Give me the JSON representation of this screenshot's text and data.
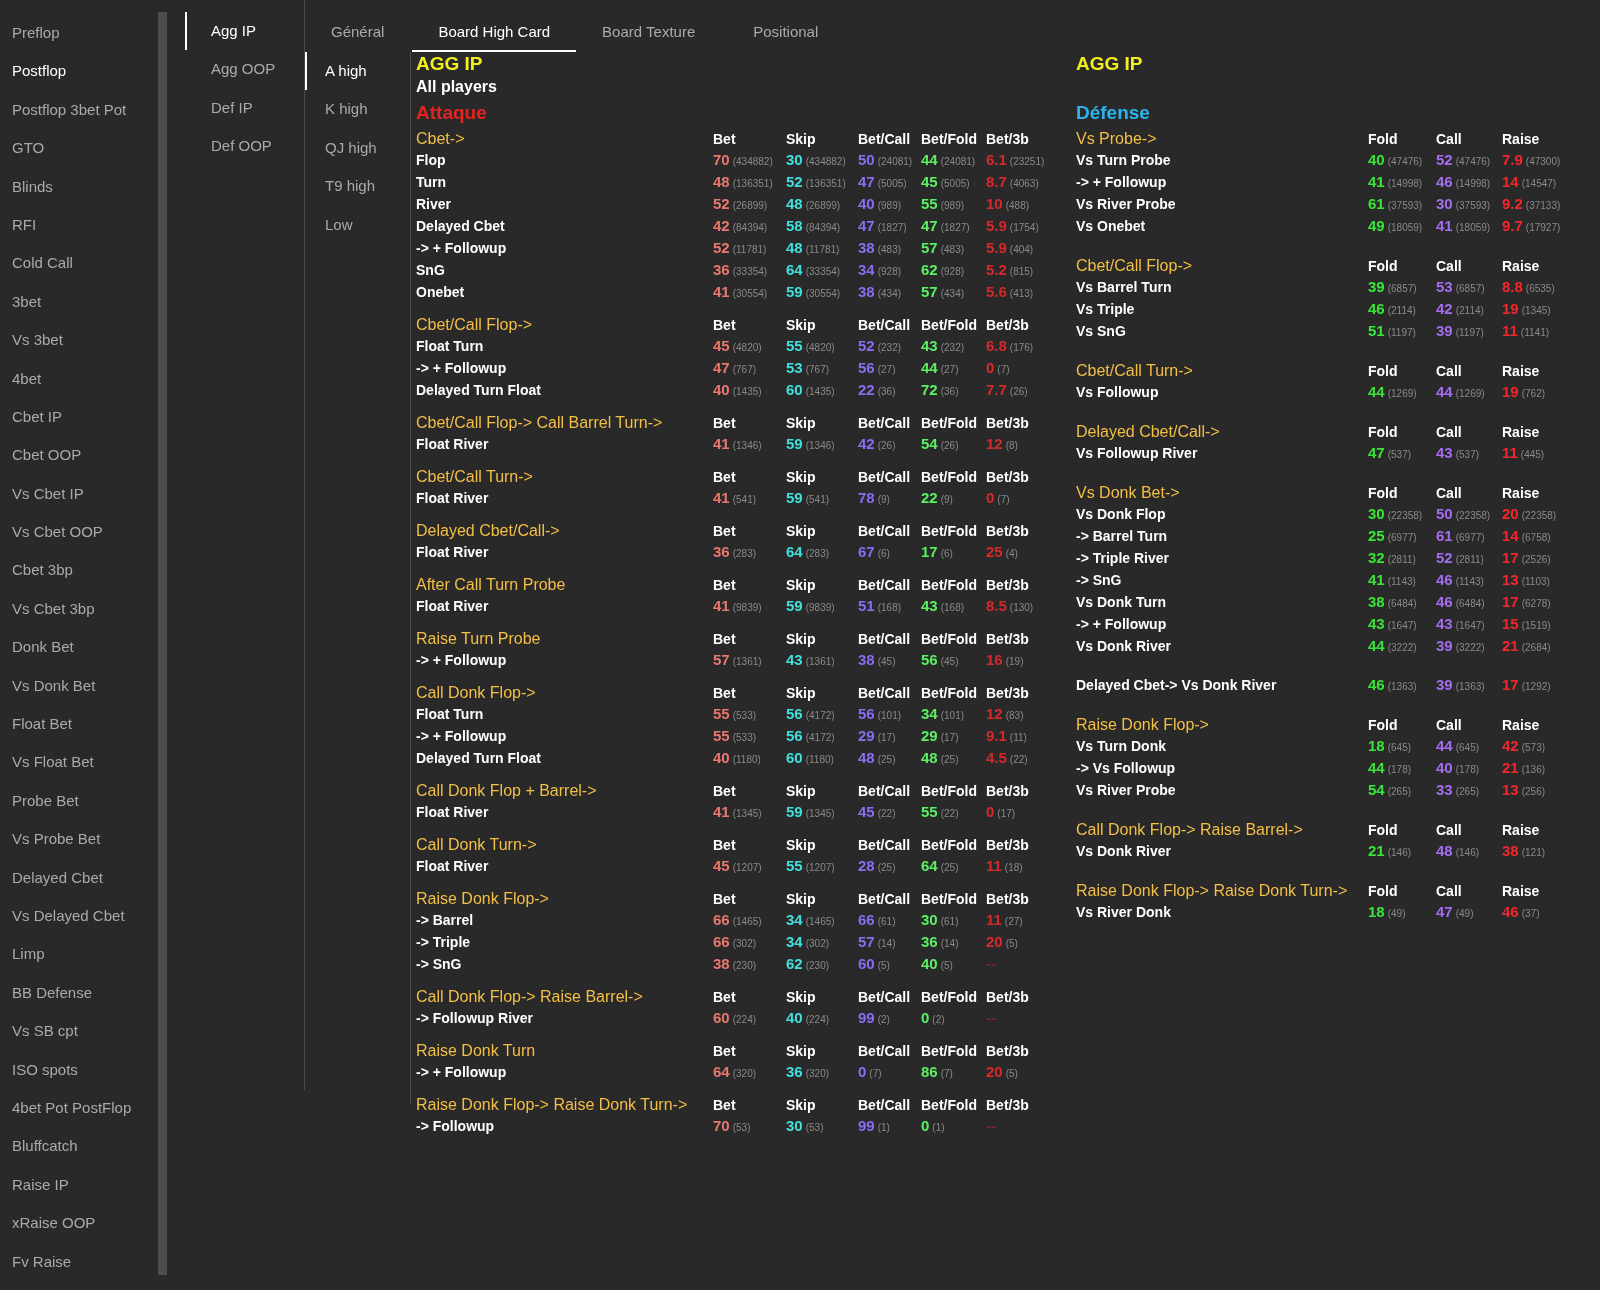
{
  "sidebar": {
    "items": [
      {
        "label": "Preflop",
        "selected": false
      },
      {
        "label": "Postflop",
        "selected": true
      },
      {
        "label": "Postflop 3bet Pot",
        "selected": false
      },
      {
        "label": "GTO",
        "selected": false
      },
      {
        "label": "Blinds",
        "selected": false
      },
      {
        "label": "RFI",
        "selected": false
      },
      {
        "label": "Cold Call",
        "selected": false
      },
      {
        "label": "3bet",
        "selected": false
      },
      {
        "label": "Vs 3bet",
        "selected": false
      },
      {
        "label": "4bet",
        "selected": false
      },
      {
        "label": "Cbet IP",
        "selected": false
      },
      {
        "label": "Cbet OOP",
        "selected": false
      },
      {
        "label": "Vs Cbet IP",
        "selected": false
      },
      {
        "label": "Vs Cbet OOP",
        "selected": false
      },
      {
        "label": "Cbet 3bp",
        "selected": false
      },
      {
        "label": "Vs Cbet 3bp",
        "selected": false
      },
      {
        "label": "Donk Bet",
        "selected": false
      },
      {
        "label": "Vs Donk Bet",
        "selected": false
      },
      {
        "label": "Float Bet",
        "selected": false
      },
      {
        "label": "Vs Float Bet",
        "selected": false
      },
      {
        "label": "Probe Bet",
        "selected": false
      },
      {
        "label": "Vs Probe Bet",
        "selected": false
      },
      {
        "label": "Delayed Cbet",
        "selected": false
      },
      {
        "label": "Vs Delayed Cbet",
        "selected": false
      },
      {
        "label": "Limp",
        "selected": false
      },
      {
        "label": "BB Defense",
        "selected": false
      },
      {
        "label": "Vs SB cpt",
        "selected": false
      },
      {
        "label": "ISO spots",
        "selected": false
      },
      {
        "label": "4bet Pot PostFlop",
        "selected": false
      },
      {
        "label": "Bluffcatch",
        "selected": false
      },
      {
        "label": "Raise IP",
        "selected": false
      },
      {
        "label": "xRaise OOP",
        "selected": false
      },
      {
        "label": "Fv Raise",
        "selected": false
      }
    ]
  },
  "role_menu": {
    "items": [
      {
        "label": "Agg IP",
        "selected": true
      },
      {
        "label": "Agg OOP",
        "selected": false
      },
      {
        "label": "Def IP",
        "selected": false
      },
      {
        "label": "Def OOP",
        "selected": false
      }
    ]
  },
  "tabs": [
    {
      "label": "Général",
      "selected": false
    },
    {
      "label": "Board High Card",
      "selected": true
    },
    {
      "label": "Board Texture",
      "selected": false
    },
    {
      "label": "Positional",
      "selected": false
    }
  ],
  "board_menu": {
    "items": [
      {
        "label": "A high",
        "selected": true
      },
      {
        "label": "K high",
        "selected": false
      },
      {
        "label": "QJ high",
        "selected": false
      },
      {
        "label": "T9 high",
        "selected": false
      },
      {
        "label": "Low",
        "selected": false
      }
    ]
  },
  "attack": {
    "heading": "AGG IP",
    "subheading": "All players",
    "title": "Attaque",
    "measures": [
      {
        "color": "#e8776e"
      },
      {
        "color": "#3fe0dc"
      },
      {
        "color": "#8b6cf2"
      },
      {
        "color": "#5cef64"
      },
      {
        "color": "#d7282c"
      }
    ],
    "sections": [
      {
        "title": "Cbet->",
        "headers": [
          "Bet",
          "Skip",
          "Bet/Call",
          "Bet/Fold",
          "Bet/3b"
        ],
        "rows": [
          {
            "label": "Flop",
            "cells": [
              [
                "70",
                "(434882)"
              ],
              [
                "30",
                "(434882)"
              ],
              [
                "50",
                "(24081)"
              ],
              [
                "44",
                "(24081)"
              ],
              [
                "6.1",
                "(23251)"
              ]
            ]
          },
          {
            "label": "Turn",
            "cells": [
              [
                "48",
                "(136351)"
              ],
              [
                "52",
                "(136351)"
              ],
              [
                "47",
                "(5005)"
              ],
              [
                "45",
                "(5005)"
              ],
              [
                "8.7",
                "(4063)"
              ]
            ]
          },
          {
            "label": "River",
            "cells": [
              [
                "52",
                "(26899)"
              ],
              [
                "48",
                "(26899)"
              ],
              [
                "40",
                "(989)"
              ],
              [
                "55",
                "(989)"
              ],
              [
                "10",
                "(488)"
              ]
            ]
          },
          {
            "label": "Delayed Cbet",
            "cells": [
              [
                "42",
                "(84394)"
              ],
              [
                "58",
                "(84394)"
              ],
              [
                "47",
                "(1827)"
              ],
              [
                "47",
                "(1827)"
              ],
              [
                "5.9",
                "(1754)"
              ]
            ]
          },
          {
            "label": "-> + Followup",
            "cells": [
              [
                "52",
                "(11781)"
              ],
              [
                "48",
                "(11781)"
              ],
              [
                "38",
                "(483)"
              ],
              [
                "57",
                "(483)"
              ],
              [
                "5.9",
                "(404)"
              ]
            ]
          },
          {
            "label": "SnG",
            "cells": [
              [
                "36",
                "(33354)"
              ],
              [
                "64",
                "(33354)"
              ],
              [
                "34",
                "(928)"
              ],
              [
                "62",
                "(928)"
              ],
              [
                "5.2",
                "(815)"
              ]
            ]
          },
          {
            "label": "Onebet",
            "cells": [
              [
                "41",
                "(30554)"
              ],
              [
                "59",
                "(30554)"
              ],
              [
                "38",
                "(434)"
              ],
              [
                "57",
                "(434)"
              ],
              [
                "5.6",
                "(413)"
              ]
            ]
          }
        ]
      },
      {
        "title": "Cbet/Call Flop->",
        "headers": [
          "Bet",
          "Skip",
          "Bet/Call",
          "Bet/Fold",
          "Bet/3b"
        ],
        "rows": [
          {
            "label": "Float Turn",
            "cells": [
              [
                "45",
                "(4820)"
              ],
              [
                "55",
                "(4820)"
              ],
              [
                "52",
                "(232)"
              ],
              [
                "43",
                "(232)"
              ],
              [
                "6.8",
                "(176)"
              ]
            ]
          },
          {
            "label": "-> + Followup",
            "cells": [
              [
                "47",
                "(767)"
              ],
              [
                "53",
                "(767)"
              ],
              [
                "56",
                "(27)"
              ],
              [
                "44",
                "(27)"
              ],
              [
                "0",
                "(7)"
              ]
            ]
          },
          {
            "label": "Delayed Turn Float",
            "cells": [
              [
                "40",
                "(1435)"
              ],
              [
                "60",
                "(1435)"
              ],
              [
                "22",
                "(36)"
              ],
              [
                "72",
                "(36)"
              ],
              [
                "7.7",
                "(26)"
              ]
            ]
          }
        ]
      },
      {
        "title": "Cbet/Call Flop-> Call Barrel Turn->",
        "headers": [
          "Bet",
          "Skip",
          "Bet/Call",
          "Bet/Fold",
          "Bet/3b"
        ],
        "rows": [
          {
            "label": "Float River",
            "cells": [
              [
                "41",
                "(1346)"
              ],
              [
                "59",
                "(1346)"
              ],
              [
                "42",
                "(26)"
              ],
              [
                "54",
                "(26)"
              ],
              [
                "12",
                "(8)"
              ]
            ]
          }
        ]
      },
      {
        "title": "Cbet/Call Turn->",
        "headers": [
          "Bet",
          "Skip",
          "Bet/Call",
          "Bet/Fold",
          "Bet/3b"
        ],
        "rows": [
          {
            "label": "Float River",
            "cells": [
              [
                "41",
                "(541)"
              ],
              [
                "59",
                "(541)"
              ],
              [
                "78",
                "(9)"
              ],
              [
                "22",
                "(9)"
              ],
              [
                "0",
                "(7)"
              ]
            ]
          }
        ]
      },
      {
        "title": "Delayed Cbet/Call->",
        "headers": [
          "Bet",
          "Skip",
          "Bet/Call",
          "Bet/Fold",
          "Bet/3b"
        ],
        "rows": [
          {
            "label": "Float River",
            "cells": [
              [
                "36",
                "(283)"
              ],
              [
                "64",
                "(283)"
              ],
              [
                "67",
                "(6)"
              ],
              [
                "17",
                "(6)"
              ],
              [
                "25",
                "(4)"
              ]
            ]
          }
        ]
      },
      {
        "title": "After Call Turn Probe",
        "headers": [
          "Bet",
          "Skip",
          "Bet/Call",
          "Bet/Fold",
          "Bet/3b"
        ],
        "rows": [
          {
            "label": "Float River",
            "cells": [
              [
                "41",
                "(9839)"
              ],
              [
                "59",
                "(9839)"
              ],
              [
                "51",
                "(168)"
              ],
              [
                "43",
                "(168)"
              ],
              [
                "8.5",
                "(130)"
              ]
            ]
          }
        ]
      },
      {
        "title": "Raise Turn Probe",
        "headers": [
          "Bet",
          "Skip",
          "Bet/Call",
          "Bet/Fold",
          "Bet/3b"
        ],
        "rows": [
          {
            "label": "-> + Followup",
            "cells": [
              [
                "57",
                "(1361)"
              ],
              [
                "43",
                "(1361)"
              ],
              [
                "38",
                "(45)"
              ],
              [
                "56",
                "(45)"
              ],
              [
                "16",
                "(19)"
              ]
            ]
          }
        ]
      },
      {
        "title": "Call Donk Flop->",
        "headers": [
          "Bet",
          "Skip",
          "Bet/Call",
          "Bet/Fold",
          "Bet/3b"
        ],
        "rows": [
          {
            "label": "Float Turn",
            "cells": [
              [
                "55",
                "(533)"
              ],
              [
                "56",
                "(4172)"
              ],
              [
                "56",
                "(101)"
              ],
              [
                "34",
                "(101)"
              ],
              [
                "12",
                "(83)"
              ]
            ]
          },
          {
            "label": "-> + Followup",
            "cells": [
              [
                "55",
                "(533)"
              ],
              [
                "56",
                "(4172)"
              ],
              [
                "29",
                "(17)"
              ],
              [
                "29",
                "(17)"
              ],
              [
                "9.1",
                "(11)"
              ]
            ]
          },
          {
            "label": "Delayed Turn Float",
            "cells": [
              [
                "40",
                "(1180)"
              ],
              [
                "60",
                "(1180)"
              ],
              [
                "48",
                "(25)"
              ],
              [
                "48",
                "(25)"
              ],
              [
                "4.5",
                "(22)"
              ]
            ]
          }
        ]
      },
      {
        "title": "Call Donk Flop + Barrel->",
        "headers": [
          "Bet",
          "Skip",
          "Bet/Call",
          "Bet/Fold",
          "Bet/3b"
        ],
        "rows": [
          {
            "label": "Float River",
            "cells": [
              [
                "41",
                "(1345)"
              ],
              [
                "59",
                "(1345)"
              ],
              [
                "45",
                "(22)"
              ],
              [
                "55",
                "(22)"
              ],
              [
                "0",
                "(17)"
              ]
            ]
          }
        ]
      },
      {
        "title": "Call Donk Turn->",
        "headers": [
          "Bet",
          "Skip",
          "Bet/Call",
          "Bet/Fold",
          "Bet/3b"
        ],
        "rows": [
          {
            "label": "Float River",
            "cells": [
              [
                "45",
                "(1207)"
              ],
              [
                "55",
                "(1207)"
              ],
              [
                "28",
                "(25)"
              ],
              [
                "64",
                "(25)"
              ],
              [
                "11",
                "(18)"
              ]
            ]
          }
        ]
      },
      {
        "title": "Raise Donk Flop->",
        "headers": [
          "Bet",
          "Skip",
          "Bet/Call",
          "Bet/Fold",
          "Bet/3b"
        ],
        "rows": [
          {
            "label": "-> Barrel",
            "cells": [
              [
                "66",
                "(1465)"
              ],
              [
                "34",
                "(1465)"
              ],
              [
                "66",
                "(61)"
              ],
              [
                "30",
                "(61)"
              ],
              [
                "11",
                "(27)"
              ]
            ]
          },
          {
            "label": "-> Triple",
            "cells": [
              [
                "66",
                "(302)"
              ],
              [
                "34",
                "(302)"
              ],
              [
                "57",
                "(14)"
              ],
              [
                "36",
                "(14)"
              ],
              [
                "20",
                "(5)"
              ]
            ]
          },
          {
            "label": "-> SnG",
            "cells": [
              [
                "38",
                "(230)"
              ],
              [
                "62",
                "(230)"
              ],
              [
                "60",
                "(5)"
              ],
              [
                "40",
                "(5)"
              ],
              [
                "--"
              ]
            ]
          }
        ]
      },
      {
        "title": "Call Donk Flop-> Raise Barrel->",
        "headers": [
          "Bet",
          "Skip",
          "Bet/Call",
          "Bet/Fold",
          "Bet/3b"
        ],
        "rows": [
          {
            "label": "-> Followup River",
            "cells": [
              [
                "60",
                "(224)"
              ],
              [
                "40",
                "(224)"
              ],
              [
                "99",
                "(2)"
              ],
              [
                "0",
                "(2)"
              ],
              [
                "--"
              ]
            ]
          }
        ]
      },
      {
        "title": "Raise Donk Turn",
        "headers": [
          "Bet",
          "Skip",
          "Bet/Call",
          "Bet/Fold",
          "Bet/3b"
        ],
        "rows": [
          {
            "label": "-> + Followup",
            "cells": [
              [
                "64",
                "(320)"
              ],
              [
                "36",
                "(320)"
              ],
              [
                "0",
                "(7)"
              ],
              [
                "86",
                "(7)"
              ],
              [
                "20",
                "(5)"
              ]
            ]
          }
        ]
      },
      {
        "title": "Raise Donk Flop-> Raise Donk Turn->",
        "headers": [
          "Bet",
          "Skip",
          "Bet/Call",
          "Bet/Fold",
          "Bet/3b"
        ],
        "rows": [
          {
            "label": "-> Followup",
            "cells": [
              [
                "70",
                "(53)"
              ],
              [
                "30",
                "(53)"
              ],
              [
                "99",
                "(1)"
              ],
              [
                "0",
                "(1)"
              ],
              [
                "--"
              ]
            ]
          }
        ]
      }
    ]
  },
  "defense": {
    "heading": "AGG IP",
    "title": "Défense",
    "measures": [
      {
        "color": "#37e637"
      },
      {
        "color": "#a66cf0"
      },
      {
        "color": "#f5262b"
      }
    ],
    "sections": [
      {
        "title": "Vs Probe->",
        "headers": [
          "Fold",
          "Call",
          "Raise"
        ],
        "rows": [
          {
            "label": "Vs Turn Probe",
            "cells": [
              [
                "40",
                "(47476)"
              ],
              [
                "52",
                "(47476)"
              ],
              [
                "7.9",
                "(47300)"
              ]
            ]
          },
          {
            "label": "-> + Followup",
            "cells": [
              [
                "41",
                "(14998)"
              ],
              [
                "46",
                "(14998)"
              ],
              [
                "14",
                "(14547)"
              ]
            ]
          },
          {
            "label": "Vs River Probe",
            "cells": [
              [
                "61",
                "(37593)"
              ],
              [
                "30",
                "(37593)"
              ],
              [
                "9.2",
                "(37133)"
              ]
            ]
          },
          {
            "label": "Vs Onebet",
            "cells": [
              [
                "49",
                "(18059)"
              ],
              [
                "41",
                "(18059)"
              ],
              [
                "9.7",
                "(17927)"
              ]
            ]
          }
        ]
      },
      {
        "title": "Cbet/Call Flop->",
        "headers": [
          "Fold",
          "Call",
          "Raise"
        ],
        "rows": [
          {
            "label": "Vs Barrel Turn",
            "cells": [
              [
                "39",
                "(6857)"
              ],
              [
                "53",
                "(6857)"
              ],
              [
                "8.8",
                "(6535)"
              ]
            ]
          },
          {
            "label": "Vs Triple",
            "cells": [
              [
                "46",
                "(2114)"
              ],
              [
                "42",
                "(2114)"
              ],
              [
                "19",
                "(1345)"
              ]
            ]
          },
          {
            "label": "Vs SnG",
            "cells": [
              [
                "51",
                "(1197)"
              ],
              [
                "39",
                "(1197)"
              ],
              [
                "11",
                "(1141)"
              ]
            ]
          }
        ]
      },
      {
        "title": "Cbet/Call Turn->",
        "headers": [
          "Fold",
          "Call",
          "Raise"
        ],
        "rows": [
          {
            "label": "Vs Followup",
            "cells": [
              [
                "44",
                "(1269)"
              ],
              [
                "44",
                "(1269)"
              ],
              [
                "19",
                "(762)"
              ]
            ]
          }
        ]
      },
      {
        "title": "Delayed Cbet/Call->",
        "headers": [
          "Fold",
          "Call",
          "Raise"
        ],
        "rows": [
          {
            "label": "Vs Followup River",
            "cells": [
              [
                "47",
                "(537)"
              ],
              [
                "43",
                "(537)"
              ],
              [
                "11",
                "(445)"
              ]
            ]
          }
        ]
      },
      {
        "title": "Vs Donk Bet->",
        "headers": [
          "Fold",
          "Call",
          "Raise"
        ],
        "rows": [
          {
            "label": "Vs Donk Flop",
            "cells": [
              [
                "30",
                "(22358)"
              ],
              [
                "50",
                "(22358)"
              ],
              [
                "20",
                "(22358)"
              ]
            ]
          },
          {
            "label": "-> Barrel Turn",
            "cells": [
              [
                "25",
                "(6977)"
              ],
              [
                "61",
                "(6977)"
              ],
              [
                "14",
                "(6758)"
              ]
            ]
          },
          {
            "label": "-> Triple River",
            "cells": [
              [
                "32",
                "(2811)"
              ],
              [
                "52",
                "(2811)"
              ],
              [
                "17",
                "(2526)"
              ]
            ]
          },
          {
            "label": "-> SnG",
            "cells": [
              [
                "41",
                "(1143)"
              ],
              [
                "46",
                "(1143)"
              ],
              [
                "13",
                "(1103)"
              ]
            ]
          },
          {
            "label": "Vs Donk Turn",
            "cells": [
              [
                "38",
                "(6484)"
              ],
              [
                "46",
                "(6484)"
              ],
              [
                "17",
                "(6278)"
              ]
            ]
          },
          {
            "label": "-> + Followup",
            "cells": [
              [
                "43",
                "(1647)"
              ],
              [
                "43",
                "(1647)"
              ],
              [
                "15",
                "(1519)"
              ]
            ]
          },
          {
            "label": "Vs Donk River",
            "cells": [
              [
                "44",
                "(3222)"
              ],
              [
                "39",
                "(3222)"
              ],
              [
                "21",
                "(2684)"
              ]
            ]
          }
        ]
      },
      {
        "rows": [
          {
            "label": "Delayed Cbet-> Vs Donk River",
            "cells": [
              [
                "46",
                "(1363)"
              ],
              [
                "39",
                "(1363)"
              ],
              [
                "17",
                "(1292)"
              ]
            ]
          }
        ]
      },
      {
        "title": "Raise Donk Flop->",
        "headers": [
          "Fold",
          "Call",
          "Raise"
        ],
        "rows": [
          {
            "label": "Vs Turn Donk",
            "cells": [
              [
                "18",
                "(645)"
              ],
              [
                "44",
                "(645)"
              ],
              [
                "42",
                "(573)"
              ]
            ]
          },
          {
            "label": "-> Vs Followup",
            "cells": [
              [
                "44",
                "(178)"
              ],
              [
                "40",
                "(178)"
              ],
              [
                "21",
                "(136)"
              ]
            ]
          },
          {
            "label": "Vs River Probe",
            "cells": [
              [
                "54",
                "(265)"
              ],
              [
                "33",
                "(265)"
              ],
              [
                "13",
                "(256)"
              ]
            ]
          }
        ]
      },
      {
        "title": "Call Donk Flop-> Raise Barrel->",
        "headers": [
          "Fold",
          "Call",
          "Raise"
        ],
        "rows": [
          {
            "label": "Vs Donk River",
            "cells": [
              [
                "21",
                "(146)"
              ],
              [
                "48",
                "(146)"
              ],
              [
                "38",
                "(121)"
              ]
            ]
          }
        ]
      },
      {
        "title": "Raise Donk Flop-> Raise Donk Turn->",
        "headers": [
          "Fold",
          "Call",
          "Raise"
        ],
        "rows": [
          {
            "label": "Vs River Donk",
            "cells": [
              [
                "18",
                "(49)"
              ],
              [
                "47",
                "(49)"
              ],
              [
                "46",
                "(37)"
              ]
            ]
          }
        ]
      }
    ]
  }
}
